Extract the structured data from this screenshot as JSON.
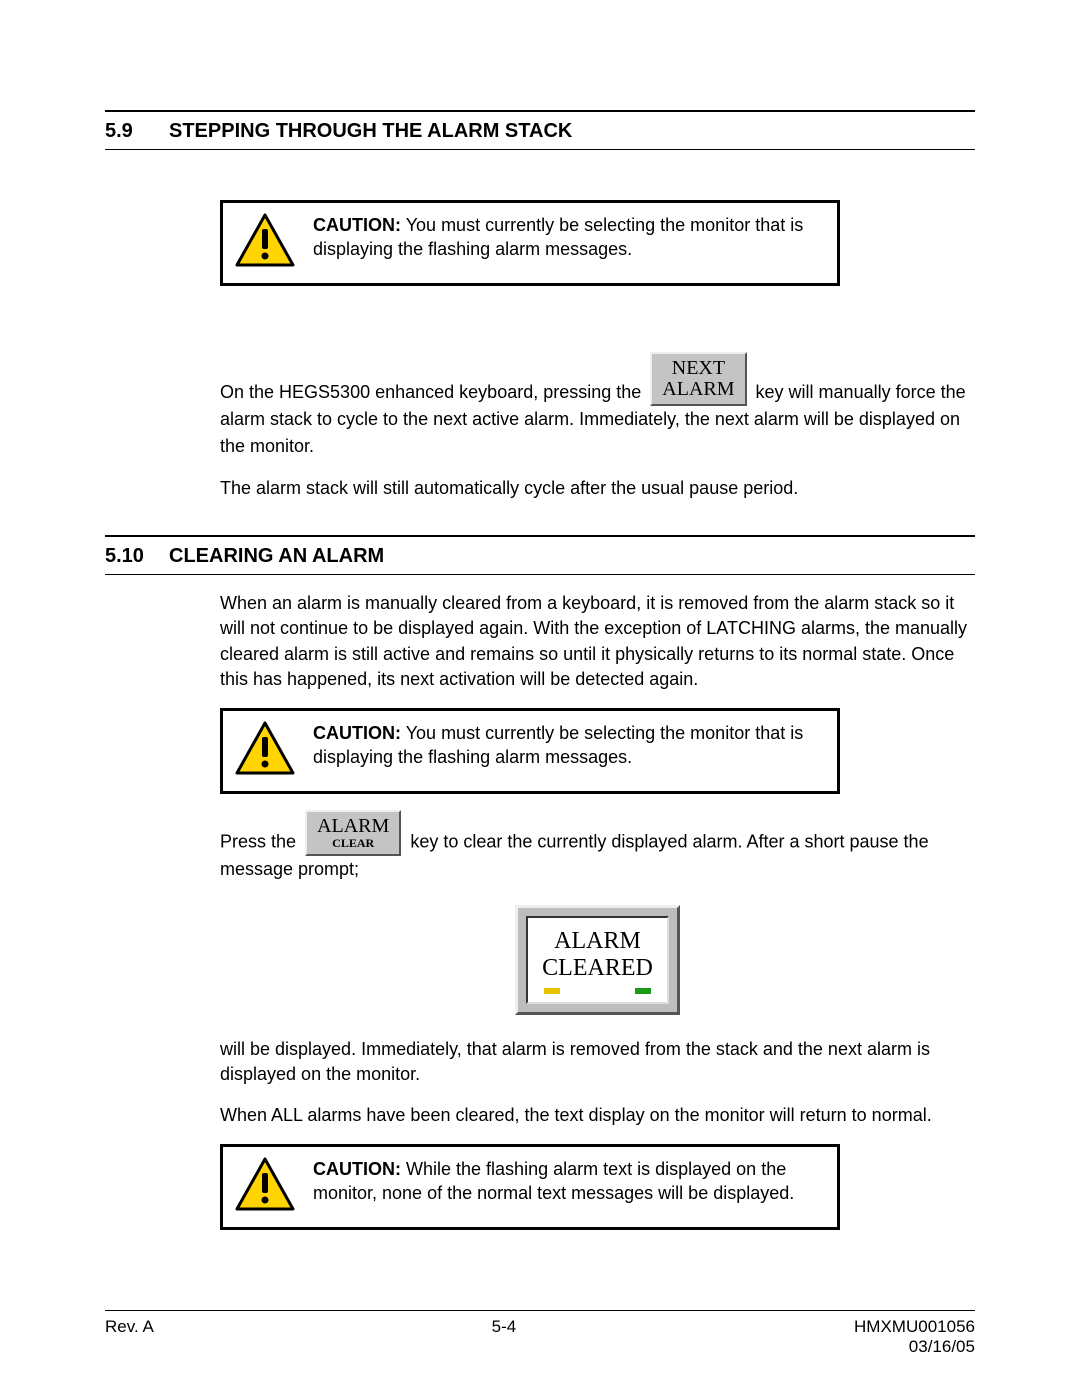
{
  "section59": {
    "num": "5.9",
    "title": "STEPPING THROUGH THE ALARM STACK",
    "caution_label": "CAUTION:",
    "caution_text": "You must currently be selecting the monitor that is displaying the flashing alarm messages.",
    "para1_a": "On the HEGS5300 enhanced keyboard, pressing the",
    "key_next_top": "NEXT",
    "key_next_bottom": "ALARM",
    "para1_b": "key will manually force the alarm stack to cycle to the next active alarm.  Immediately, the next alarm will be displayed on the monitor.",
    "para2": "The alarm stack will still automatically cycle after the usual pause period."
  },
  "section510": {
    "num": "5.10",
    "title": "CLEARING AN ALARM",
    "para1": "When an alarm is manually cleared from a keyboard, it is removed from the alarm stack so it will not continue to be displayed again.  With the exception of LATCHING alarms, the manually cleared alarm is still active and remains so until it physically returns to its normal state.  Once this has happened, its next activation will be detected again.",
    "caution1_label": "CAUTION:",
    "caution1_text": "You must currently be selecting the monitor that is displaying the flashing alarm messages.",
    "para2_a": "Press the",
    "key_alarm_top": "ALARM",
    "key_alarm_bottom": "CLEAR",
    "para2_b": "key to clear the currently displayed alarm.  After a short pause the message prompt;",
    "screen_line1": "ALARM",
    "screen_line2": "CLEARED",
    "para3": "will be displayed.  Immediately, that alarm is removed from the stack and the next alarm is displayed on the monitor.",
    "para4": "When ALL alarms have been cleared, the text display on the monitor will return to normal.",
    "caution2_label": "CAUTION:",
    "caution2_text": "While the flashing alarm text is displayed on the monitor, none of the normal text messages will be displayed."
  },
  "footer": {
    "rev": "Rev. A",
    "page": "5-4",
    "doc": "HMXMU001056",
    "date": "03/16/05"
  }
}
